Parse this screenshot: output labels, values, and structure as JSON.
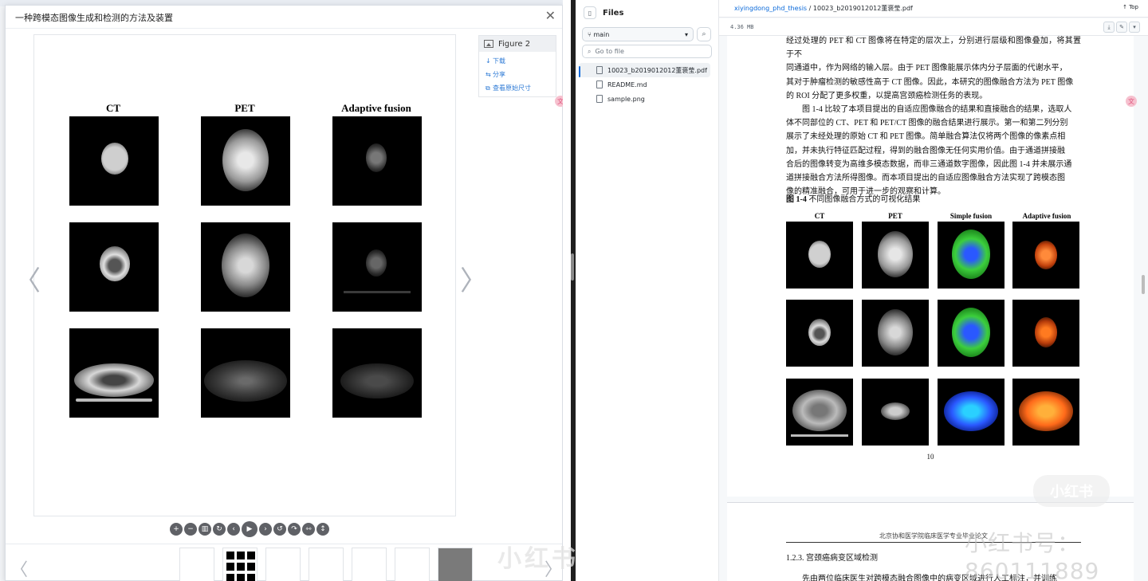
{
  "viewer": {
    "title": "一种跨模态图像生成和检测的方法及装置",
    "figure_label": "Figure 2",
    "links": [
      "下载",
      "分享",
      "查看原始尺寸"
    ],
    "column_headers": [
      "CT",
      "PET",
      "Adaptive fusion"
    ]
  },
  "files": {
    "title": "Files",
    "branch": "main",
    "goto_placeholder": "Go to file",
    "items": [
      "10023_b2019012012董褒莹.pdf",
      "README.md",
      "sample.png"
    ]
  },
  "pdf": {
    "repo": "xiyingdong_phd_thesis",
    "separator": "/",
    "file": "10023_b2019012012董褒莹.pdf",
    "top_label": "Top",
    "size": "4.36 MB",
    "paragraph_lines": [
      "经过处理的 PET 和 CT 图像将在特定的层次上，分别进行层级和图像叠加，将其置于不",
      "同通道中，作为网络的输入层。由于 PET 图像能展示体内分子层面的代谢水平，",
      "其对于肿瘤检测的敏感性高于 CT 图像。因此，本研究的图像融合方法为 PET 图像",
      "的 ROI 分配了更多权重，以提高宫颈癌检测任务的表现。",
      "　　图 1-4 比较了本项目提出的自适应图像融合的结果和直接融合的结果，选取人",
      "体不同部位的 CT、PET 和 PET/CT 图像的融合结果进行展示。第一和第二列分别",
      "展示了未经处理的原始 CT 和 PET 图像。简单融合算法仅将两个图像的像素点相",
      "加，并未执行特征匹配过程，得到的融合图像无任何实用价值。由于通道拼接融",
      "合后的图像转变为高维多模态数据，而非三通道数字图像，因此图 1-4 并未展示通",
      "道拼接融合方法所得图像。而本项目提出的自适应图像融合方法实现了跨模态图",
      "像的精准融合，可用于进一步的观察和计算。"
    ],
    "figure_caption_num": "图 1-4",
    "figure_caption_text": "不同图像融合方式的可视化结果",
    "column_headers": [
      "CT",
      "PET",
      "Simple fusion",
      "Adaptive fusion"
    ],
    "page_number": "10",
    "page2_header": "北京协和医学院临床医学专业毕业论文",
    "section_heading": "1.2.3.  宫颈癌病变区域检测",
    "page2_text": "先由两位临床医生对跨模态融合图像中的病变区域进行人工标注，并训练"
  },
  "watermark": {
    "phone": "小红书号：860111889",
    "brand": "小红书",
    "logo": "小红书"
  },
  "colors": {
    "accent": "#0969da",
    "link": "#2f7bd6",
    "pet_green": "#3ccf3c",
    "pet_blue": "#2a58ff",
    "adaptive_orange": "#ff6a1a"
  }
}
